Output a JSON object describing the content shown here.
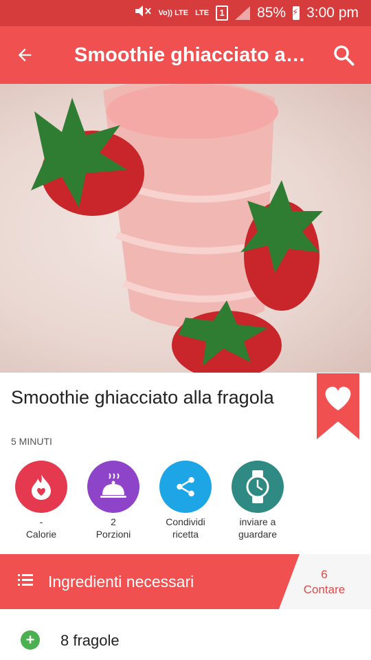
{
  "status_bar": {
    "volte": "Vo)) LTE",
    "network": "LTE",
    "sim": "1",
    "battery": "85%",
    "time": "3:00 pm"
  },
  "app_bar": {
    "title": "Smoothie ghiacciato al…",
    "back_icon": "arrow-back-icon",
    "search_icon": "search-icon"
  },
  "recipe": {
    "title": "Smoothie ghiacciato alla fragola",
    "time": "5 MINUTI"
  },
  "actions": [
    {
      "icon": "flame-heart-icon",
      "value": "-",
      "label": "Calorie",
      "color": "#e53950"
    },
    {
      "icon": "cloche-icon",
      "value": "2",
      "label": "Porzioni",
      "color": "#8e44c9"
    },
    {
      "icon": "share-icon",
      "value": "Condividi",
      "label": "ricetta",
      "color": "#1ea5e6"
    },
    {
      "icon": "watch-icon",
      "value": "inviare a",
      "label": "guardare",
      "color": "#2f8a84"
    }
  ],
  "ingredients_header": {
    "title": "Ingredienti necessari",
    "count_value": "6",
    "count_label": "Contare"
  },
  "ingredients": [
    {
      "text": "8 fragole"
    }
  ],
  "colors": {
    "primary": "#f0504f",
    "status_bar": "#d73c3c"
  }
}
